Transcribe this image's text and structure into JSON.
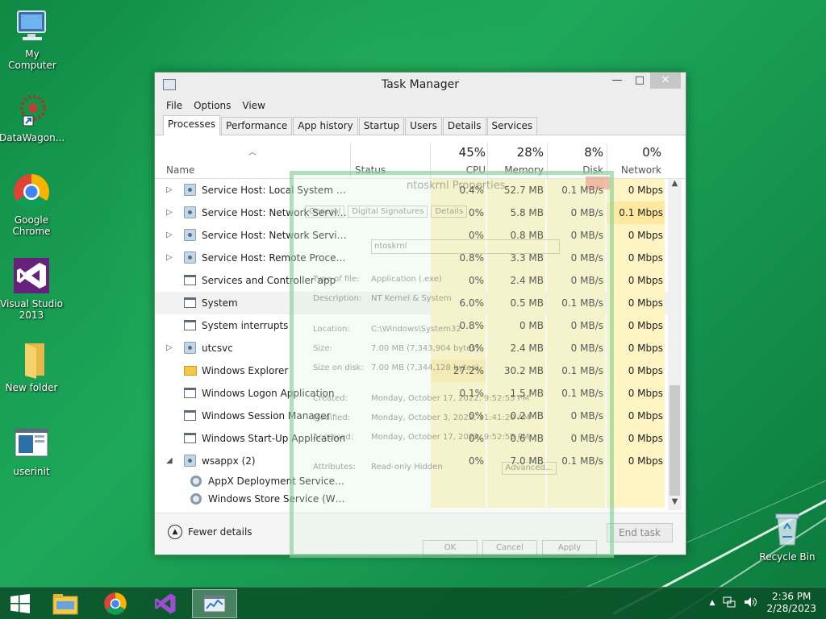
{
  "desktop": {
    "icons": [
      {
        "label": "My Computer",
        "icon": "computer-icon"
      },
      {
        "label": "DataWagon...",
        "icon": "datawagon-icon"
      },
      {
        "label": "Google Chrome",
        "icon": "chrome-icon"
      },
      {
        "label": "Visual Studio 2013",
        "icon": "visual-studio-icon"
      },
      {
        "label": "New folder",
        "icon": "folder-icon"
      },
      {
        "label": "userinit",
        "icon": "userinit-icon"
      },
      {
        "label": "Recycle Bin",
        "icon": "recycle-bin-icon"
      }
    ]
  },
  "window": {
    "title": "Task Manager",
    "controls": {
      "minimize": "—",
      "maximize": "□",
      "close": "✕"
    },
    "menu": [
      "File",
      "Options",
      "View"
    ],
    "tabs": [
      "Processes",
      "Performance",
      "App history",
      "Startup",
      "Users",
      "Details",
      "Services"
    ],
    "active_tab": "Processes",
    "columns": {
      "name": "Name",
      "status": "Status",
      "cpu": {
        "label": "CPU",
        "percent": "45%"
      },
      "memory": {
        "label": "Memory",
        "percent": "28%"
      },
      "disk": {
        "label": "Disk",
        "percent": "8%"
      },
      "network": {
        "label": "Network",
        "percent": "0%"
      }
    },
    "rows": [
      {
        "expand": "▷",
        "icon": "service",
        "name": "Service Host: Local System (Net...",
        "cpu": "0.4%",
        "mem": "52.7 MB",
        "disk": "0.1 MB/s",
        "net": "0 Mbps"
      },
      {
        "expand": "▷",
        "icon": "service",
        "name": "Service Host: Network Service (5)",
        "cpu": "0%",
        "mem": "5.8 MB",
        "disk": "0 MB/s",
        "net": "0.1 Mbps"
      },
      {
        "expand": "▷",
        "icon": "service",
        "name": "Service Host: Network Service (...",
        "cpu": "0%",
        "mem": "0.8 MB",
        "disk": "0 MB/s",
        "net": "0 Mbps"
      },
      {
        "expand": "▷",
        "icon": "service",
        "name": "Service Host: Remote Procedure...",
        "cpu": "0.8%",
        "mem": "3.3 MB",
        "disk": "0 MB/s",
        "net": "0 Mbps"
      },
      {
        "expand": "",
        "icon": "app",
        "name": "Services and Controller app",
        "cpu": "0%",
        "mem": "2.4 MB",
        "disk": "0 MB/s",
        "net": "0 Mbps"
      },
      {
        "expand": "",
        "icon": "app",
        "name": "System",
        "cpu": "6.0%",
        "mem": "0.5 MB",
        "disk": "0.1 MB/s",
        "net": "0 Mbps",
        "selected": true
      },
      {
        "expand": "",
        "icon": "app",
        "name": "System interrupts",
        "cpu": "0.8%",
        "mem": "0 MB",
        "disk": "0 MB/s",
        "net": "0 Mbps"
      },
      {
        "expand": "▷",
        "icon": "service",
        "name": "utcsvc",
        "cpu": "0%",
        "mem": "2.4 MB",
        "disk": "0 MB/s",
        "net": "0 Mbps"
      },
      {
        "expand": "",
        "icon": "folder",
        "name": "Windows Explorer",
        "cpu": "27.2%",
        "mem": "30.2 MB",
        "disk": "0.1 MB/s",
        "net": "0 Mbps"
      },
      {
        "expand": "",
        "icon": "app",
        "name": "Windows Logon Application",
        "cpu": "0.1%",
        "mem": "1.5 MB",
        "disk": "0.1 MB/s",
        "net": "0 Mbps"
      },
      {
        "expand": "",
        "icon": "app",
        "name": "Windows Session Manager",
        "cpu": "0%",
        "mem": "0.2 MB",
        "disk": "0 MB/s",
        "net": "0 Mbps"
      },
      {
        "expand": "",
        "icon": "app",
        "name": "Windows Start-Up Application",
        "cpu": "0%",
        "mem": "0.6 MB",
        "disk": "0 MB/s",
        "net": "0 Mbps"
      },
      {
        "expand": "◢",
        "icon": "service",
        "name": "wsappx (2)",
        "cpu": "0%",
        "mem": "7.0 MB",
        "disk": "0.1 MB/s",
        "net": "0 Mbps"
      },
      {
        "expand": "",
        "icon": "gear",
        "name": "AppX Deployment Service (Ap...",
        "cpu": "",
        "mem": "",
        "disk": "",
        "net": "",
        "sub": true
      },
      {
        "expand": "",
        "icon": "gear",
        "name": "Windows Store Service (WSSer...",
        "cpu": "",
        "mem": "",
        "disk": "",
        "net": "",
        "sub": true
      }
    ],
    "footer": {
      "fewer_details": "Fewer details",
      "end_task": "End task"
    }
  },
  "ghost_dialog": {
    "title": "ntoskrnl Properties",
    "tabs": [
      "General",
      "Digital Signatures",
      "Details"
    ],
    "file_name": "ntoskrnl",
    "fields": [
      {
        "label": "Type of file:",
        "value": "Application (.exe)"
      },
      {
        "label": "Description:",
        "value": "NT Kernel & System"
      },
      {
        "label": "Location:",
        "value": "C:\\Windows\\System32"
      },
      {
        "label": "Size:",
        "value": "7.00 MB (7,343,904 bytes)"
      },
      {
        "label": "Size on disk:",
        "value": "7.00 MB (7,344,128 bytes)"
      },
      {
        "label": "Created:",
        "value": "Monday, October 17, 2022, 9:52:55 PM"
      },
      {
        "label": "Modified:",
        "value": "Monday, October 3, 2022, 11:41:20 AM"
      },
      {
        "label": "Accessed:",
        "value": "Monday, October 17, 2022, 9:52:55 PM"
      },
      {
        "label": "Attributes:",
        "value": "Read-only   Hidden"
      }
    ],
    "advanced": "Advanced...",
    "buttons": {
      "ok": "OK",
      "cancel": "Cancel",
      "apply": "Apply"
    }
  },
  "taskbar": {
    "items": [
      "windows-start-icon",
      "file-explorer-icon",
      "chrome-icon",
      "visual-studio-icon",
      "task-manager-icon"
    ],
    "time": "2:36 PM",
    "date": "2/28/2023"
  },
  "colors": {
    "accent": "#1ea85a",
    "heat": "#fff4c4",
    "heat_hot": "#fde8a5"
  }
}
